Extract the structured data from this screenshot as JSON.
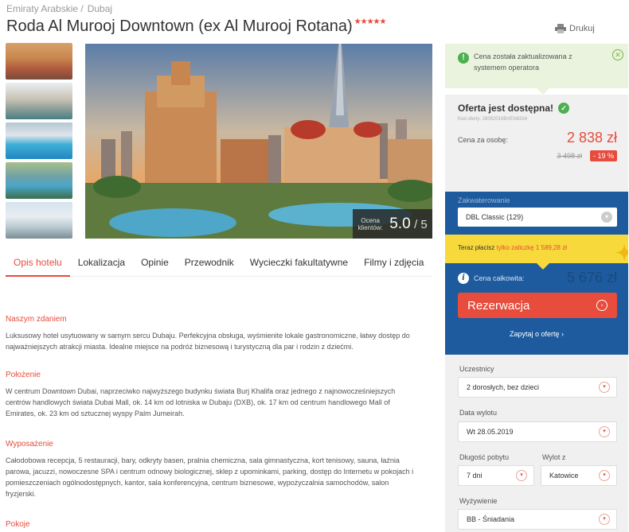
{
  "breadcrumb": [
    "Emiraty Arabskie /",
    "Dubaj"
  ],
  "hotel": {
    "name": "Roda Al Murooj Downtown (ex Al Murooj Rotana)",
    "stars": "★★★★★"
  },
  "print_label": "Drukuj",
  "rating": {
    "label": "Ocena klientów:",
    "value": "5.0",
    "max": "/ 5"
  },
  "tabs": [
    "Opis hotelu",
    "Lokalizacja",
    "Opinie",
    "Przewodnik",
    "Wycieczki fakultatywne",
    "Filmy i zdjęcia"
  ],
  "sections": [
    {
      "title": "Naszym zdaniem",
      "text": "Luksusowy hotel usytuowany w samym sercu Dubaju. Perfekcyjna obsługa, wyśmienite lokale gastronomiczne, łatwy dostęp do najważniejszych atrakcji miasta. Idealne miejsce na podróż biznesową i turystyczną dla par i rodzin z dziećmi."
    },
    {
      "title": "Położenie",
      "text": "W centrum Downtown Dubai, naprzeciwko najwyższego budynku świata Burj Khalifa oraz jednego z najnowocześniejszych centrów handlowych świata Dubai Mall, ok. 14 km od lotniska w Dubaju (DXB), ok. 17 km od centrum handlowego Mall of Emirates, ok. 23 km od sztucznej wyspy Palm Jumeirah."
    },
    {
      "title": "Wyposażenie",
      "text": "Całodobowa recepcja, 5 restauracji, bary, odkryty basen, pralnia chemiczna, sala gimnastyczna, kort tenisowy, sauna, łaźnia parowa, jacuzzi, nowoczesne SPA i centrum odnowy biologicznej, sklep z upominkami, parking, dostęp do Internetu w pokojach i pomieszczeniach ogólnodostępnych, kantor, sala konferencyjna, centrum biznesowe, wypożyczalnia samochodów, salon fryzjerski."
    },
    {
      "title": "Pokoje",
      "text": ""
    }
  ],
  "sidebar": {
    "notice": "Cena została zaktualizowana z systemem operatora",
    "notice_close": "✕",
    "available": "Oferta jest dostępna!",
    "offer_code": "Kod oferty: 28052019BVEN6334",
    "per_person_label": "Cena za osobę:",
    "price": "2 838 zł",
    "old_price": "3 498 zł",
    "discount": "- 19 %",
    "accommodation_label": "Zakwaterowanie",
    "accommodation_value": "DBL Classic (129)",
    "deposit_prefix": "Teraz płacisz",
    "deposit_highlight": "tylko zaliczkę 1 589,28 zł",
    "total_label": "Cena całkowita:",
    "total_value": "5 676 zł",
    "reserve_button": "Rezerwacja",
    "ask_link": "Zapytaj o ofertę ›",
    "participants_label": "Uczestnicy",
    "participants_value": "2 dorosłych, bez dzieci",
    "date_label": "Data wylotu",
    "date_value": "Wt 28.05.2019",
    "duration_label": "Długość pobytu",
    "duration_value": "7 dni",
    "departure_label": "Wylot z",
    "departure_value": "Katowice",
    "board_label": "Wyżywienie",
    "board_value": "BB - Śniadania"
  },
  "colors": {
    "accent": "#e74c3c",
    "blue": "#1d5b9e",
    "yellow": "#f7d93b",
    "green": "#4caf50"
  }
}
